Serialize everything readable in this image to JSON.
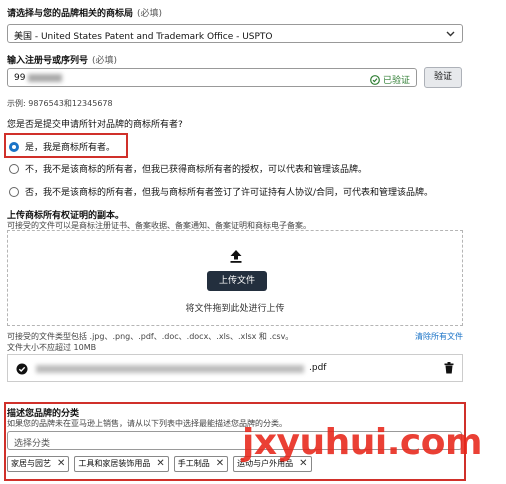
{
  "trademark_office": {
    "label": "请选择与您的品牌相关的商标局",
    "required": "(必填)",
    "value": "美国 - United States Patent and Trademark Office - USPTO"
  },
  "registration": {
    "label": "输入注册号或序列号",
    "required": "(必填)",
    "value": "99",
    "verified_text": "已验证",
    "verify_button": "验证",
    "example": "示例: 9876543和12345678"
  },
  "owner_question": {
    "label": "您是否是提交申请所针对品牌的商标所有者?",
    "options": [
      "是，我是商标所有者。",
      "不，我不是该商标的所有者，但我已获得商标所有者的授权，可以代表和管理该品牌。",
      "否，我不是该商标的所有者，但我与商标所有者签订了许可证持有人协议/合同，可代表和管理该品牌。"
    ]
  },
  "upload": {
    "title": "上传商标所有权证明的副本。",
    "subtitle": "可接受的文件可以是商标注册证书、备案收据、备案通知、备案证明和商标电子备案。",
    "button": "上传文件",
    "drag_text": "将文件拖到此处进行上传",
    "accepted_types": "可接受的文件类型包括 .jpg、.png、.pdf、.doc、.docx、.xls、.xlsx 和 .csv。",
    "size_limit": "文件大小不应超过 10MB",
    "clear_all": "清除所有文件",
    "file_ext": ".pdf"
  },
  "category": {
    "title": "描述您品牌的分类",
    "subtitle": "如果您的品牌未在亚马逊上销售，请从以下列表中选择最能描述您品牌的分类。",
    "placeholder": "选择分类",
    "chips": [
      "家居与园艺",
      "工具和家居装饰用品",
      "手工制品",
      "运动与户外用品"
    ]
  },
  "watermark": "jxyuhui.com",
  "colors": {
    "highlight_border": "#d0302a",
    "watermark": "#e8261a",
    "accent": "#1a73c7",
    "verified_green": "#2e7d32"
  }
}
